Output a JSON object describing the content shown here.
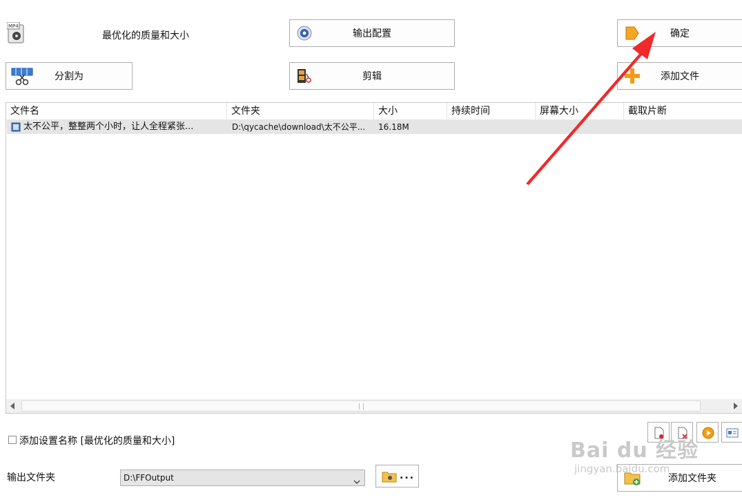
{
  "toolbar": {
    "profile_label": "最优化的质量和大小",
    "output_config_label": "输出配置",
    "ok_label": "确定",
    "split_label": "分割为",
    "edit_label": "剪辑",
    "add_file_label": "添加文件"
  },
  "file_list": {
    "columns": [
      "文件名",
      "文件夹",
      "大小",
      "持续时间",
      "屏幕大小",
      "截取片断"
    ],
    "rows": [
      {
        "name": "太不公平，整整两个小时，让人全程紧张...",
        "folder": "D:\\qycache\\download\\太不公平...",
        "size": "16.18M",
        "duration": "",
        "screen": "",
        "clip": ""
      }
    ]
  },
  "bottom": {
    "add_setting_name_label": "添加设置名称 [最优化的质量和大小]",
    "output_folder_label": "输出文件夹",
    "output_folder_value": "D:\\FFOutput",
    "browse_label": "...",
    "add_folder_label": "添加文件夹"
  },
  "watermark": {
    "text_top": "Bai du 经验",
    "text_bottom": "jingyan.baidu.com"
  },
  "colors": {
    "arrow": "#f02a2a",
    "row_selected": "#e5e5e5",
    "scroll_track": "#f0f0f0"
  }
}
